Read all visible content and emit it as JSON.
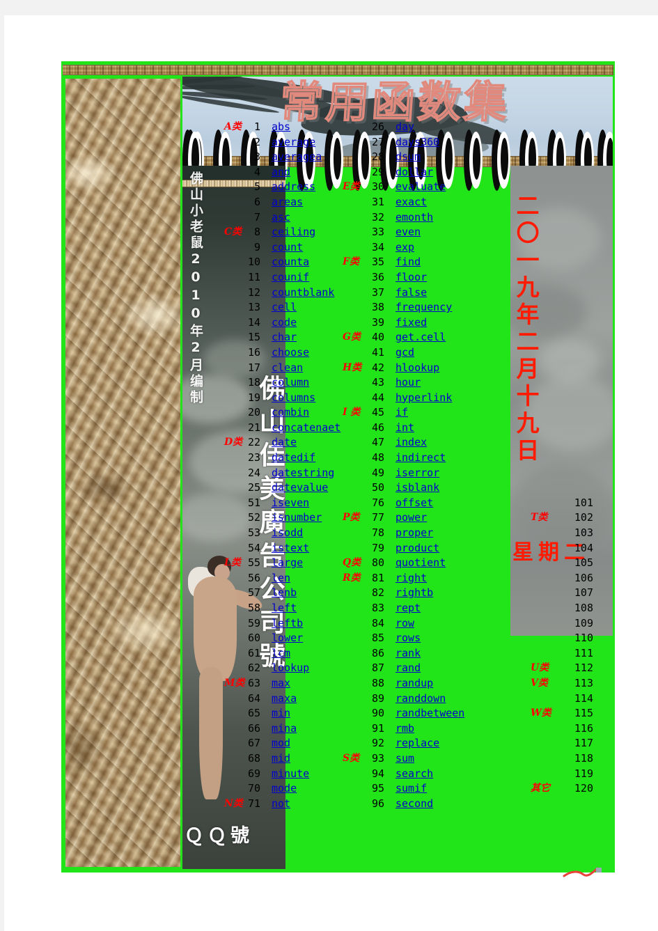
{
  "poster": {
    "title": "常用函数集",
    "date_vertical": "二〇一九年二月十九日",
    "weekday": "星期二",
    "credit_small": "佛山小老鼠2010年2月编制",
    "credit_big": "佛山佳美廣告公司號",
    "credit_qq": "ＱＱ號",
    "colors": {
      "frame_green": "#22e519",
      "link_blue": "#0000cc",
      "category_red": "#ff0000",
      "title_stroke": "#e1897d",
      "paper_tan": "#b08a52"
    }
  },
  "index": {
    "rows": [
      {
        "cat_a": "A类",
        "num_a": "1",
        "fn_a": "abs",
        "cat_b": "",
        "num_b": "26",
        "fn_b": "day",
        "cat_c": "",
        "num_c": ""
      },
      {
        "cat_a": "",
        "num_a": "2",
        "fn_a": "average",
        "cat_b": "",
        "num_b": "27",
        "fn_b": "days360",
        "cat_c": "",
        "num_c": ""
      },
      {
        "cat_a": "",
        "num_a": "3",
        "fn_a": "averagea",
        "cat_b": "",
        "num_b": "28",
        "fn_b": "dsum",
        "cat_c": "",
        "num_c": ""
      },
      {
        "cat_a": "",
        "num_a": "4",
        "fn_a": "and",
        "cat_b": "",
        "num_b": "29",
        "fn_b": "dollar",
        "cat_c": "",
        "num_c": ""
      },
      {
        "cat_a": "",
        "num_a": "5",
        "fn_a": "address",
        "cat_b": "E类",
        "num_b": "30",
        "fn_b": "evaluate",
        "cat_c": "",
        "num_c": ""
      },
      {
        "cat_a": "",
        "num_a": "6",
        "fn_a": "areas",
        "cat_b": "",
        "num_b": "31",
        "fn_b": "exact",
        "cat_c": "",
        "num_c": ""
      },
      {
        "cat_a": "",
        "num_a": "7",
        "fn_a": "asc",
        "cat_b": "",
        "num_b": "32",
        "fn_b": "emonth",
        "cat_c": "",
        "num_c": ""
      },
      {
        "cat_a": "C类",
        "num_a": "8",
        "fn_a": "ceiling",
        "cat_b": "",
        "num_b": "33",
        "fn_b": "even",
        "cat_c": "",
        "num_c": ""
      },
      {
        "cat_a": "",
        "num_a": "9",
        "fn_a": "count",
        "cat_b": "",
        "num_b": "34",
        "fn_b": "exp",
        "cat_c": "",
        "num_c": ""
      },
      {
        "cat_a": "",
        "num_a": "10",
        "fn_a": "counta",
        "cat_b": "F类",
        "num_b": "35",
        "fn_b": "find",
        "cat_c": "",
        "num_c": ""
      },
      {
        "cat_a": "",
        "num_a": "11",
        "fn_a": "counif",
        "cat_b": "",
        "num_b": "36",
        "fn_b": "floor",
        "cat_c": "",
        "num_c": ""
      },
      {
        "cat_a": "",
        "num_a": "12",
        "fn_a": "countblank",
        "cat_b": "",
        "num_b": "37",
        "fn_b": "false",
        "cat_c": "",
        "num_c": ""
      },
      {
        "cat_a": "",
        "num_a": "13",
        "fn_a": "cell",
        "cat_b": "",
        "num_b": "38",
        "fn_b": "frequency",
        "cat_c": "",
        "num_c": ""
      },
      {
        "cat_a": "",
        "num_a": "14",
        "fn_a": "code",
        "cat_b": "",
        "num_b": "39",
        "fn_b": "fixed",
        "cat_c": "",
        "num_c": ""
      },
      {
        "cat_a": "",
        "num_a": "15",
        "fn_a": "char",
        "cat_b": "G类",
        "num_b": "40",
        "fn_b": "get.cell",
        "cat_c": "",
        "num_c": ""
      },
      {
        "cat_a": "",
        "num_a": "16",
        "fn_a": "choose",
        "cat_b": "",
        "num_b": "41",
        "fn_b": "gcd",
        "cat_c": "",
        "num_c": ""
      },
      {
        "cat_a": "",
        "num_a": "17",
        "fn_a": "clean",
        "cat_b": "H类",
        "num_b": "42",
        "fn_b": "hlookup",
        "cat_c": "",
        "num_c": ""
      },
      {
        "cat_a": "",
        "num_a": "18",
        "fn_a": "column",
        "cat_b": "",
        "num_b": "43",
        "fn_b": "hour",
        "cat_c": "",
        "num_c": ""
      },
      {
        "cat_a": "",
        "num_a": "19",
        "fn_a": "columns",
        "cat_b": "",
        "num_b": "44",
        "fn_b": "hyperlink",
        "cat_c": "",
        "num_c": ""
      },
      {
        "cat_a": "",
        "num_a": "20",
        "fn_a": "combin",
        "cat_b": "I 类",
        "num_b": "45",
        "fn_b": "if",
        "cat_c": "",
        "num_c": ""
      },
      {
        "cat_a": "",
        "num_a": "21",
        "fn_a": "concatenaet",
        "cat_b": "",
        "num_b": "46",
        "fn_b": "int",
        "cat_c": "",
        "num_c": ""
      },
      {
        "cat_a": "D类",
        "num_a": "22",
        "fn_a": "date",
        "cat_b": "",
        "num_b": "47",
        "fn_b": "index",
        "cat_c": "",
        "num_c": ""
      },
      {
        "cat_a": "",
        "num_a": "23",
        "fn_a": "datedif",
        "cat_b": "",
        "num_b": "48",
        "fn_b": "indirect",
        "cat_c": "",
        "num_c": ""
      },
      {
        "cat_a": "",
        "num_a": "24",
        "fn_a": "datestring",
        "cat_b": "",
        "num_b": "49",
        "fn_b": "iserror",
        "cat_c": "",
        "num_c": ""
      },
      {
        "cat_a": "",
        "num_a": "25",
        "fn_a": "datevalue",
        "cat_b": "",
        "num_b": "50",
        "fn_b": "isblank",
        "cat_c": "",
        "num_c": ""
      },
      {
        "cat_a": "",
        "num_a": "51",
        "fn_a": "iseven",
        "cat_b": "",
        "num_b": "76",
        "fn_b": "offset",
        "cat_c": "",
        "num_c": "101"
      },
      {
        "cat_a": "",
        "num_a": "52",
        "fn_a": "isnumber",
        "cat_b": "P类",
        "num_b": "77",
        "fn_b": "power",
        "cat_c": "T类",
        "num_c": "102"
      },
      {
        "cat_a": "",
        "num_a": "53",
        "fn_a": "isodd",
        "cat_b": "",
        "num_b": "78",
        "fn_b": "proper",
        "cat_c": "",
        "num_c": "103"
      },
      {
        "cat_a": "",
        "num_a": "54",
        "fn_a": "istext",
        "cat_b": "",
        "num_b": "79",
        "fn_b": "product",
        "cat_c": "",
        "num_c": "104"
      },
      {
        "cat_a": "L类",
        "num_a": "55",
        "fn_a": "large",
        "cat_b": "Q类",
        "num_b": "80",
        "fn_b": "quotient",
        "cat_c": "",
        "num_c": "105"
      },
      {
        "cat_a": "",
        "num_a": "56",
        "fn_a": "len",
        "cat_b": "R类",
        "num_b": "81",
        "fn_b": "right",
        "cat_c": "",
        "num_c": "106"
      },
      {
        "cat_a": "",
        "num_a": "57",
        "fn_a": "lenb",
        "cat_b": "",
        "num_b": "82",
        "fn_b": "rightb",
        "cat_c": "",
        "num_c": "107"
      },
      {
        "cat_a": "",
        "num_a": "58",
        "fn_a": "left",
        "cat_b": "",
        "num_b": "83",
        "fn_b": "rept",
        "cat_c": "",
        "num_c": "108"
      },
      {
        "cat_a": "",
        "num_a": "59",
        "fn_a": "leftb",
        "cat_b": "",
        "num_b": "84",
        "fn_b": "row",
        "cat_c": "",
        "num_c": "109"
      },
      {
        "cat_a": "",
        "num_a": "60",
        "fn_a": "lower",
        "cat_b": "",
        "num_b": "85",
        "fn_b": "rows",
        "cat_c": "",
        "num_c": "110"
      },
      {
        "cat_a": "",
        "num_a": "61",
        "fn_a": "lcm",
        "cat_b": "",
        "num_b": "86",
        "fn_b": "rank",
        "cat_c": "",
        "num_c": "111"
      },
      {
        "cat_a": "",
        "num_a": "62",
        "fn_a": "lookup",
        "cat_b": "",
        "num_b": "87",
        "fn_b": "rand",
        "cat_c": "U类",
        "num_c": "112"
      },
      {
        "cat_a": "M类",
        "num_a": "63",
        "fn_a": "max",
        "cat_b": "",
        "num_b": "88",
        "fn_b": "randup",
        "cat_c": "V类",
        "num_c": "113"
      },
      {
        "cat_a": "",
        "num_a": "64",
        "fn_a": "maxa",
        "cat_b": "",
        "num_b": "89",
        "fn_b": "randdown",
        "cat_c": "",
        "num_c": "114"
      },
      {
        "cat_a": "",
        "num_a": "65",
        "fn_a": "min",
        "cat_b": "",
        "num_b": "90",
        "fn_b": "randbetween",
        "cat_c": "W类",
        "num_c": "115"
      },
      {
        "cat_a": "",
        "num_a": "66",
        "fn_a": "mina",
        "cat_b": "",
        "num_b": "91",
        "fn_b": "rmb",
        "cat_c": "",
        "num_c": "116"
      },
      {
        "cat_a": "",
        "num_a": "67",
        "fn_a": "mod",
        "cat_b": "",
        "num_b": "92",
        "fn_b": "replace",
        "cat_c": "",
        "num_c": "117"
      },
      {
        "cat_a": "",
        "num_a": "68",
        "fn_a": "mid",
        "cat_b": "S类",
        "num_b": "93",
        "fn_b": "sum",
        "cat_c": "",
        "num_c": "118"
      },
      {
        "cat_a": "",
        "num_a": "69",
        "fn_a": "minute",
        "cat_b": "",
        "num_b": "94",
        "fn_b": "search",
        "cat_c": "",
        "num_c": "119"
      },
      {
        "cat_a": "",
        "num_a": "70",
        "fn_a": "mode",
        "cat_b": "",
        "num_b": "95",
        "fn_b": "sumif",
        "cat_c": "其它",
        "num_c": "120"
      },
      {
        "cat_a": "N类",
        "num_a": "71",
        "fn_a": "not",
        "cat_b": "",
        "num_b": "96",
        "fn_b": "second",
        "cat_c": "",
        "num_c": ""
      }
    ]
  }
}
